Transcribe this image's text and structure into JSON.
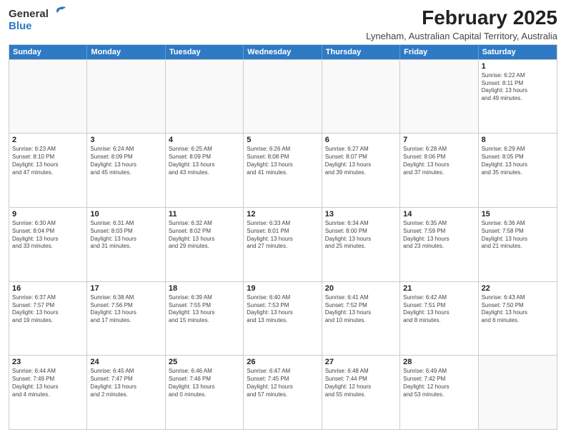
{
  "logo": {
    "general": "General",
    "blue": "Blue"
  },
  "title": "February 2025",
  "subtitle": "Lyneham, Australian Capital Territory, Australia",
  "weekdays": [
    "Sunday",
    "Monday",
    "Tuesday",
    "Wednesday",
    "Thursday",
    "Friday",
    "Saturday"
  ],
  "weeks": [
    [
      {
        "day": "",
        "info": "",
        "empty": true
      },
      {
        "day": "",
        "info": "",
        "empty": true
      },
      {
        "day": "",
        "info": "",
        "empty": true
      },
      {
        "day": "",
        "info": "",
        "empty": true
      },
      {
        "day": "",
        "info": "",
        "empty": true
      },
      {
        "day": "",
        "info": "",
        "empty": true
      },
      {
        "day": "1",
        "info": "Sunrise: 6:22 AM\nSunset: 8:11 PM\nDaylight: 13 hours\nand 49 minutes.",
        "empty": false
      }
    ],
    [
      {
        "day": "2",
        "info": "Sunrise: 6:23 AM\nSunset: 8:10 PM\nDaylight: 13 hours\nand 47 minutes.",
        "empty": false
      },
      {
        "day": "3",
        "info": "Sunrise: 6:24 AM\nSunset: 8:09 PM\nDaylight: 13 hours\nand 45 minutes.",
        "empty": false
      },
      {
        "day": "4",
        "info": "Sunrise: 6:25 AM\nSunset: 8:09 PM\nDaylight: 13 hours\nand 43 minutes.",
        "empty": false
      },
      {
        "day": "5",
        "info": "Sunrise: 6:26 AM\nSunset: 8:08 PM\nDaylight: 13 hours\nand 41 minutes.",
        "empty": false
      },
      {
        "day": "6",
        "info": "Sunrise: 6:27 AM\nSunset: 8:07 PM\nDaylight: 13 hours\nand 39 minutes.",
        "empty": false
      },
      {
        "day": "7",
        "info": "Sunrise: 6:28 AM\nSunset: 8:06 PM\nDaylight: 13 hours\nand 37 minutes.",
        "empty": false
      },
      {
        "day": "8",
        "info": "Sunrise: 6:29 AM\nSunset: 8:05 PM\nDaylight: 13 hours\nand 35 minutes.",
        "empty": false
      }
    ],
    [
      {
        "day": "9",
        "info": "Sunrise: 6:30 AM\nSunset: 8:04 PM\nDaylight: 13 hours\nand 33 minutes.",
        "empty": false
      },
      {
        "day": "10",
        "info": "Sunrise: 6:31 AM\nSunset: 8:03 PM\nDaylight: 13 hours\nand 31 minutes.",
        "empty": false
      },
      {
        "day": "11",
        "info": "Sunrise: 6:32 AM\nSunset: 8:02 PM\nDaylight: 13 hours\nand 29 minutes.",
        "empty": false
      },
      {
        "day": "12",
        "info": "Sunrise: 6:33 AM\nSunset: 8:01 PM\nDaylight: 13 hours\nand 27 minutes.",
        "empty": false
      },
      {
        "day": "13",
        "info": "Sunrise: 6:34 AM\nSunset: 8:00 PM\nDaylight: 13 hours\nand 25 minutes.",
        "empty": false
      },
      {
        "day": "14",
        "info": "Sunrise: 6:35 AM\nSunset: 7:59 PM\nDaylight: 13 hours\nand 23 minutes.",
        "empty": false
      },
      {
        "day": "15",
        "info": "Sunrise: 6:36 AM\nSunset: 7:58 PM\nDaylight: 13 hours\nand 21 minutes.",
        "empty": false
      }
    ],
    [
      {
        "day": "16",
        "info": "Sunrise: 6:37 AM\nSunset: 7:57 PM\nDaylight: 13 hours\nand 19 minutes.",
        "empty": false
      },
      {
        "day": "17",
        "info": "Sunrise: 6:38 AM\nSunset: 7:56 PM\nDaylight: 13 hours\nand 17 minutes.",
        "empty": false
      },
      {
        "day": "18",
        "info": "Sunrise: 6:39 AM\nSunset: 7:55 PM\nDaylight: 13 hours\nand 15 minutes.",
        "empty": false
      },
      {
        "day": "19",
        "info": "Sunrise: 6:40 AM\nSunset: 7:53 PM\nDaylight: 13 hours\nand 13 minutes.",
        "empty": false
      },
      {
        "day": "20",
        "info": "Sunrise: 6:41 AM\nSunset: 7:52 PM\nDaylight: 13 hours\nand 10 minutes.",
        "empty": false
      },
      {
        "day": "21",
        "info": "Sunrise: 6:42 AM\nSunset: 7:51 PM\nDaylight: 13 hours\nand 8 minutes.",
        "empty": false
      },
      {
        "day": "22",
        "info": "Sunrise: 6:43 AM\nSunset: 7:50 PM\nDaylight: 13 hours\nand 6 minutes.",
        "empty": false
      }
    ],
    [
      {
        "day": "23",
        "info": "Sunrise: 6:44 AM\nSunset: 7:49 PM\nDaylight: 13 hours\nand 4 minutes.",
        "empty": false
      },
      {
        "day": "24",
        "info": "Sunrise: 6:45 AM\nSunset: 7:47 PM\nDaylight: 13 hours\nand 2 minutes.",
        "empty": false
      },
      {
        "day": "25",
        "info": "Sunrise: 6:46 AM\nSunset: 7:46 PM\nDaylight: 13 hours\nand 0 minutes.",
        "empty": false
      },
      {
        "day": "26",
        "info": "Sunrise: 6:47 AM\nSunset: 7:45 PM\nDaylight: 12 hours\nand 57 minutes.",
        "empty": false
      },
      {
        "day": "27",
        "info": "Sunrise: 6:48 AM\nSunset: 7:44 PM\nDaylight: 12 hours\nand 55 minutes.",
        "empty": false
      },
      {
        "day": "28",
        "info": "Sunrise: 6:49 AM\nSunset: 7:42 PM\nDaylight: 12 hours\nand 53 minutes.",
        "empty": false
      },
      {
        "day": "",
        "info": "",
        "empty": true
      }
    ]
  ]
}
